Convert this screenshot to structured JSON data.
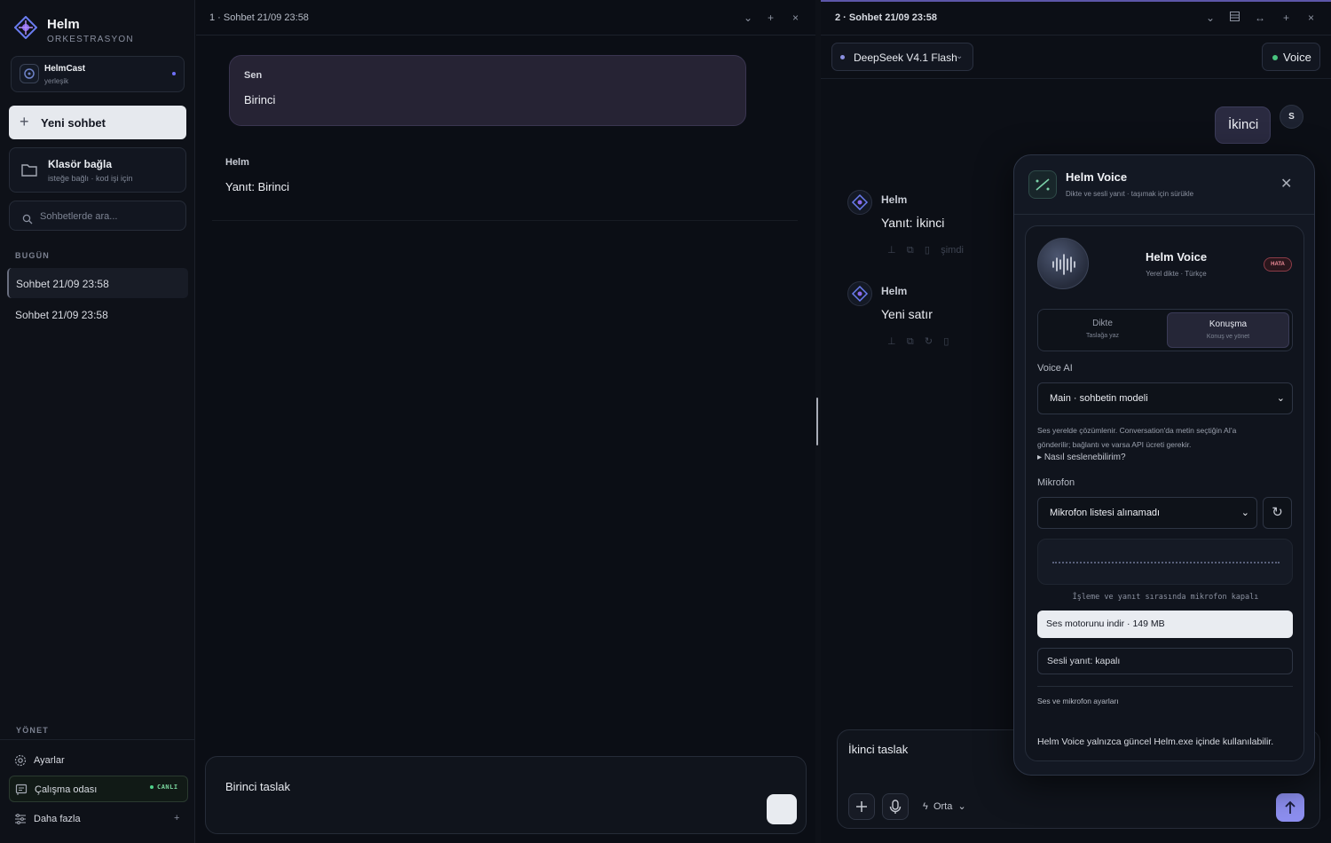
{
  "sidebar": {
    "brand_title": "Helm",
    "brand_subtitle": "ORKESTRASYON",
    "helmcast": {
      "name": "HelmCast",
      "status": "yerleşik"
    },
    "new_chat": "Yeni sohbet",
    "folder": {
      "title": "Klasör bağla",
      "subtitle": "isteğe bağlı · kod işi için"
    },
    "search_placeholder": "Sohbetlerde ara...",
    "today_label": "BUGÜN",
    "history": [
      "Sohbet 21/09 23:58",
      "Sohbet 21/09 23:58"
    ],
    "manage_label": "YÖNET",
    "nav": {
      "settings": "Ayarlar",
      "workroom": "Çalışma odası",
      "workroom_badge": "CANLI",
      "more": "Daha fazla",
      "more_plus": "+"
    }
  },
  "pane1": {
    "title": "1 · Sohbet 21/09 23:58",
    "user_label": "Sen",
    "user_message": "Birinci",
    "assistant_label": "Helm",
    "assistant_reply": "Yanıt: Birinci",
    "composer_text": "Birinci taslak"
  },
  "pane2": {
    "title": "2 · Sohbet 21/09 23:58",
    "model": "DeepSeek V4.1 Flash",
    "voice_button": "Voice",
    "user_message": "İkinci",
    "user_avatar": "S",
    "messages": [
      {
        "who": "Helm",
        "text": "Yanıt: İkinci",
        "time": "şimdi"
      },
      {
        "who": "Helm",
        "text": "Yeni satır"
      }
    ],
    "composer_text": "İkinci taslak",
    "effort": "Orta"
  },
  "voice_panel": {
    "title": "Helm Voice",
    "subtitle": "Dikte ve sesli yanıt · taşımak için sürükle",
    "card_title": "Helm Voice",
    "card_subtitle": "Yerel dikte · Türkçe",
    "error_badge": "HATA",
    "modes": [
      {
        "title": "Dikte",
        "subtitle": "Taslağa yaz"
      },
      {
        "title": "Konuşma",
        "subtitle": "Konuş ve yönet"
      }
    ],
    "voice_ai_label": "Voice AI",
    "voice_ai_value": "Main · sohbetin modeli",
    "note_line1": "Ses yerelde çözümlenir. Conversation'da metin seçtiğin AI'a",
    "note_line2": "gönderilir; bağlantı ve varsa API ücreti gerekir.",
    "how_label": "Nasıl seslenebilirim?",
    "mic_label": "Mikrofon",
    "mic_value": "Mikrofon listesi alınamadı",
    "mic_note": "İşleme ve yanıt sırasında mikrofon kapalı",
    "download_button": "Ses motorunu indir · 149 MB",
    "spoken_reply": "Sesli yanıt: kapalı",
    "settings_link": "Ses ve mikrofon ayarları",
    "warning": "Helm Voice yalnızca güncel Helm.exe içinde kullanılabilir."
  }
}
